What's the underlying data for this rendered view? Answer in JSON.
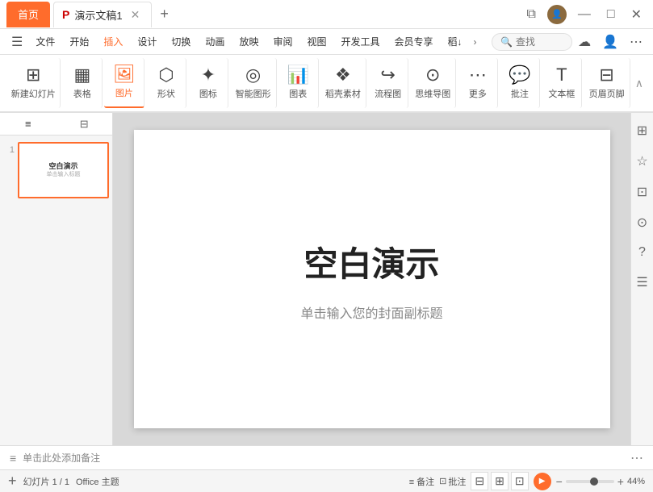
{
  "titleBar": {
    "homeTab": "首页",
    "docTab": "演示文稿1",
    "pIcon": "P",
    "addTab": "+",
    "windowBtns": [
      "▢▢",
      "—",
      "□",
      "✕"
    ]
  },
  "menuBar": {
    "items": [
      {
        "label": "文件",
        "active": false
      },
      {
        "label": "开始",
        "active": false
      },
      {
        "label": "插入",
        "active": true
      },
      {
        "label": "设计",
        "active": false
      },
      {
        "label": "切换",
        "active": false
      },
      {
        "label": "动画",
        "active": false
      },
      {
        "label": "放映",
        "active": false
      },
      {
        "label": "审阅",
        "active": false
      },
      {
        "label": "视图",
        "active": false
      },
      {
        "label": "开发工具",
        "active": false
      },
      {
        "label": "会员专享",
        "active": false
      },
      {
        "label": "稻↓",
        "active": false
      }
    ],
    "searchPlaceholder": "查找"
  },
  "ribbon": {
    "groups": [
      {
        "label": "新建幻灯片",
        "icon": "🖼",
        "hasArrow": true
      },
      {
        "label": "表格",
        "icon": "⊞",
        "hasArrow": true
      },
      {
        "label": "图片",
        "icon": "🖼",
        "hasArrow": true,
        "active": true
      },
      {
        "label": "形状",
        "icon": "⬡",
        "hasArrow": true
      },
      {
        "label": "图标",
        "icon": "★",
        "hasArrow": true
      },
      {
        "label": "智能图形",
        "icon": "◎"
      },
      {
        "label": "图表",
        "icon": "📊",
        "hasArrow": true
      },
      {
        "label": "稻壳素材",
        "icon": "⬡"
      },
      {
        "label": "流程图",
        "icon": "↪",
        "hasArrow": true
      },
      {
        "label": "思维导图",
        "icon": "⊙",
        "hasArrow": true
      },
      {
        "label": "更多",
        "icon": "···",
        "hasArrow": true
      },
      {
        "label": "批注",
        "icon": "💬"
      },
      {
        "label": "文本框",
        "icon": "T"
      },
      {
        "label": "页眉页脚",
        "icon": "⊟"
      }
    ]
  },
  "slidePanel": {
    "tabs": [
      "≡",
      "⊟"
    ],
    "slideNum": "1",
    "slideTitle": "空白演示",
    "slideSubtitle": "单击输入标题"
  },
  "canvas": {
    "title": "空白演示",
    "subtitle": "单击输入您的封面副标题"
  },
  "notesBar": {
    "placeholder": "单击此处添加备注"
  },
  "statusBar": {
    "slideInfo": "幻灯片 1 / 1",
    "theme": "Office 主题",
    "notesLabel": "备注",
    "commentLabel": "批注",
    "zoom": "44%",
    "moreBtn": "···"
  }
}
